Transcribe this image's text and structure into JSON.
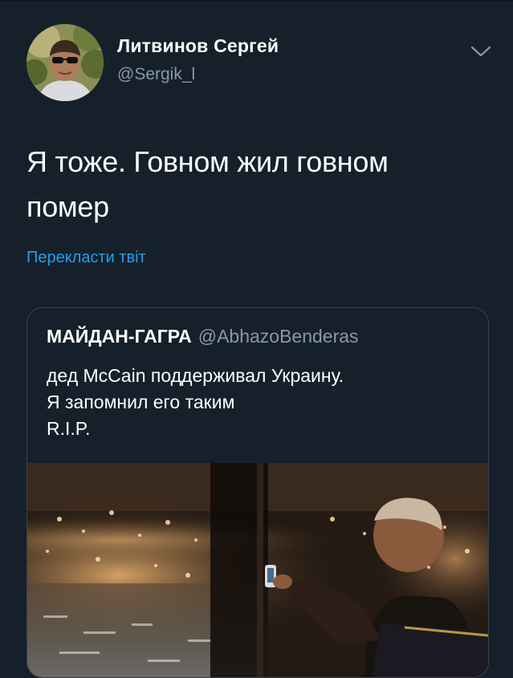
{
  "tweet": {
    "author": {
      "name": "Литвинов Сергей",
      "handle": "@Sergik_l"
    },
    "text": "Я тоже. Говном жил говном\nпомер",
    "translate_label": "Перекласти твіт",
    "menu_icon": "chevron-down-icon"
  },
  "quoted_tweet": {
    "author": {
      "name": "МАЙДАН-ГАГРА",
      "handle": "@AbhazoBenderas"
    },
    "text": "дед McCain  поддерживал Украину.\nЯ запомнил его таким\n R.I.P."
  },
  "colors": {
    "background": "#15202b",
    "secondary_text": "#8899a6",
    "link": "#1da1f2",
    "border": "#38444d"
  }
}
